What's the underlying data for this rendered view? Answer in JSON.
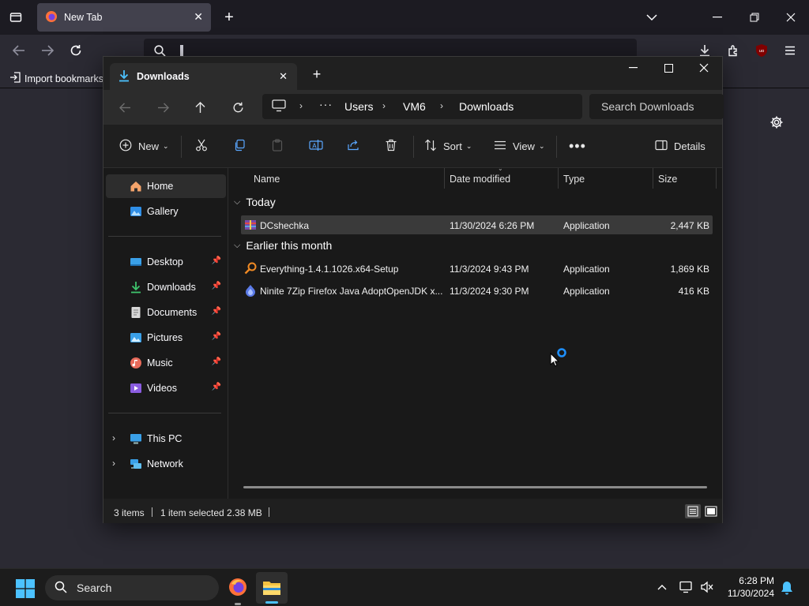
{
  "browser": {
    "tab_title": "New Tab",
    "bookmarks_item": "Import bookmarks..."
  },
  "explorer": {
    "tab_title": "Downloads",
    "breadcrumb": [
      "Users",
      "VM6",
      "Downloads"
    ],
    "search_placeholder": "Search Downloads",
    "toolbar": {
      "new_label": "New",
      "sort_label": "Sort",
      "view_label": "View",
      "details_label": "Details"
    },
    "sidebar": {
      "home": "Home",
      "gallery": "Gallery",
      "pinned": [
        {
          "label": "Desktop",
          "icon": "desktop-icon"
        },
        {
          "label": "Downloads",
          "icon": "downloads-icon"
        },
        {
          "label": "Documents",
          "icon": "documents-icon"
        },
        {
          "label": "Pictures",
          "icon": "pictures-icon"
        },
        {
          "label": "Music",
          "icon": "music-icon"
        },
        {
          "label": "Videos",
          "icon": "videos-icon"
        }
      ],
      "this_pc": "This PC",
      "network": "Network"
    },
    "columns": {
      "name": "Name",
      "date": "Date modified",
      "type": "Type",
      "size": "Size"
    },
    "groups": [
      {
        "title": "Today",
        "files": [
          {
            "name": "DCshechka",
            "date": "11/30/2024 6:26 PM",
            "type": "Application",
            "size": "2,447 KB",
            "selected": true
          }
        ]
      },
      {
        "title": "Earlier this month",
        "files": [
          {
            "name": "Everything-1.4.1.1026.x64-Setup",
            "date": "11/3/2024 9:43 PM",
            "type": "Application",
            "size": "1,869 KB",
            "selected": false
          },
          {
            "name": "Ninite 7Zip Firefox Java AdoptOpenJDK x...",
            "date": "11/3/2024 9:30 PM",
            "type": "Application",
            "size": "416 KB",
            "selected": false
          }
        ]
      }
    ],
    "status": {
      "items": "3 items",
      "selected": "1 item selected  2.38 MB"
    }
  },
  "taskbar": {
    "search_label": "Search",
    "time": "6:28 PM",
    "date": "11/30/2024"
  },
  "colors": {
    "accent": "#4cc2ff",
    "selection": "#3a3a3a",
    "ublock": "#800000"
  }
}
